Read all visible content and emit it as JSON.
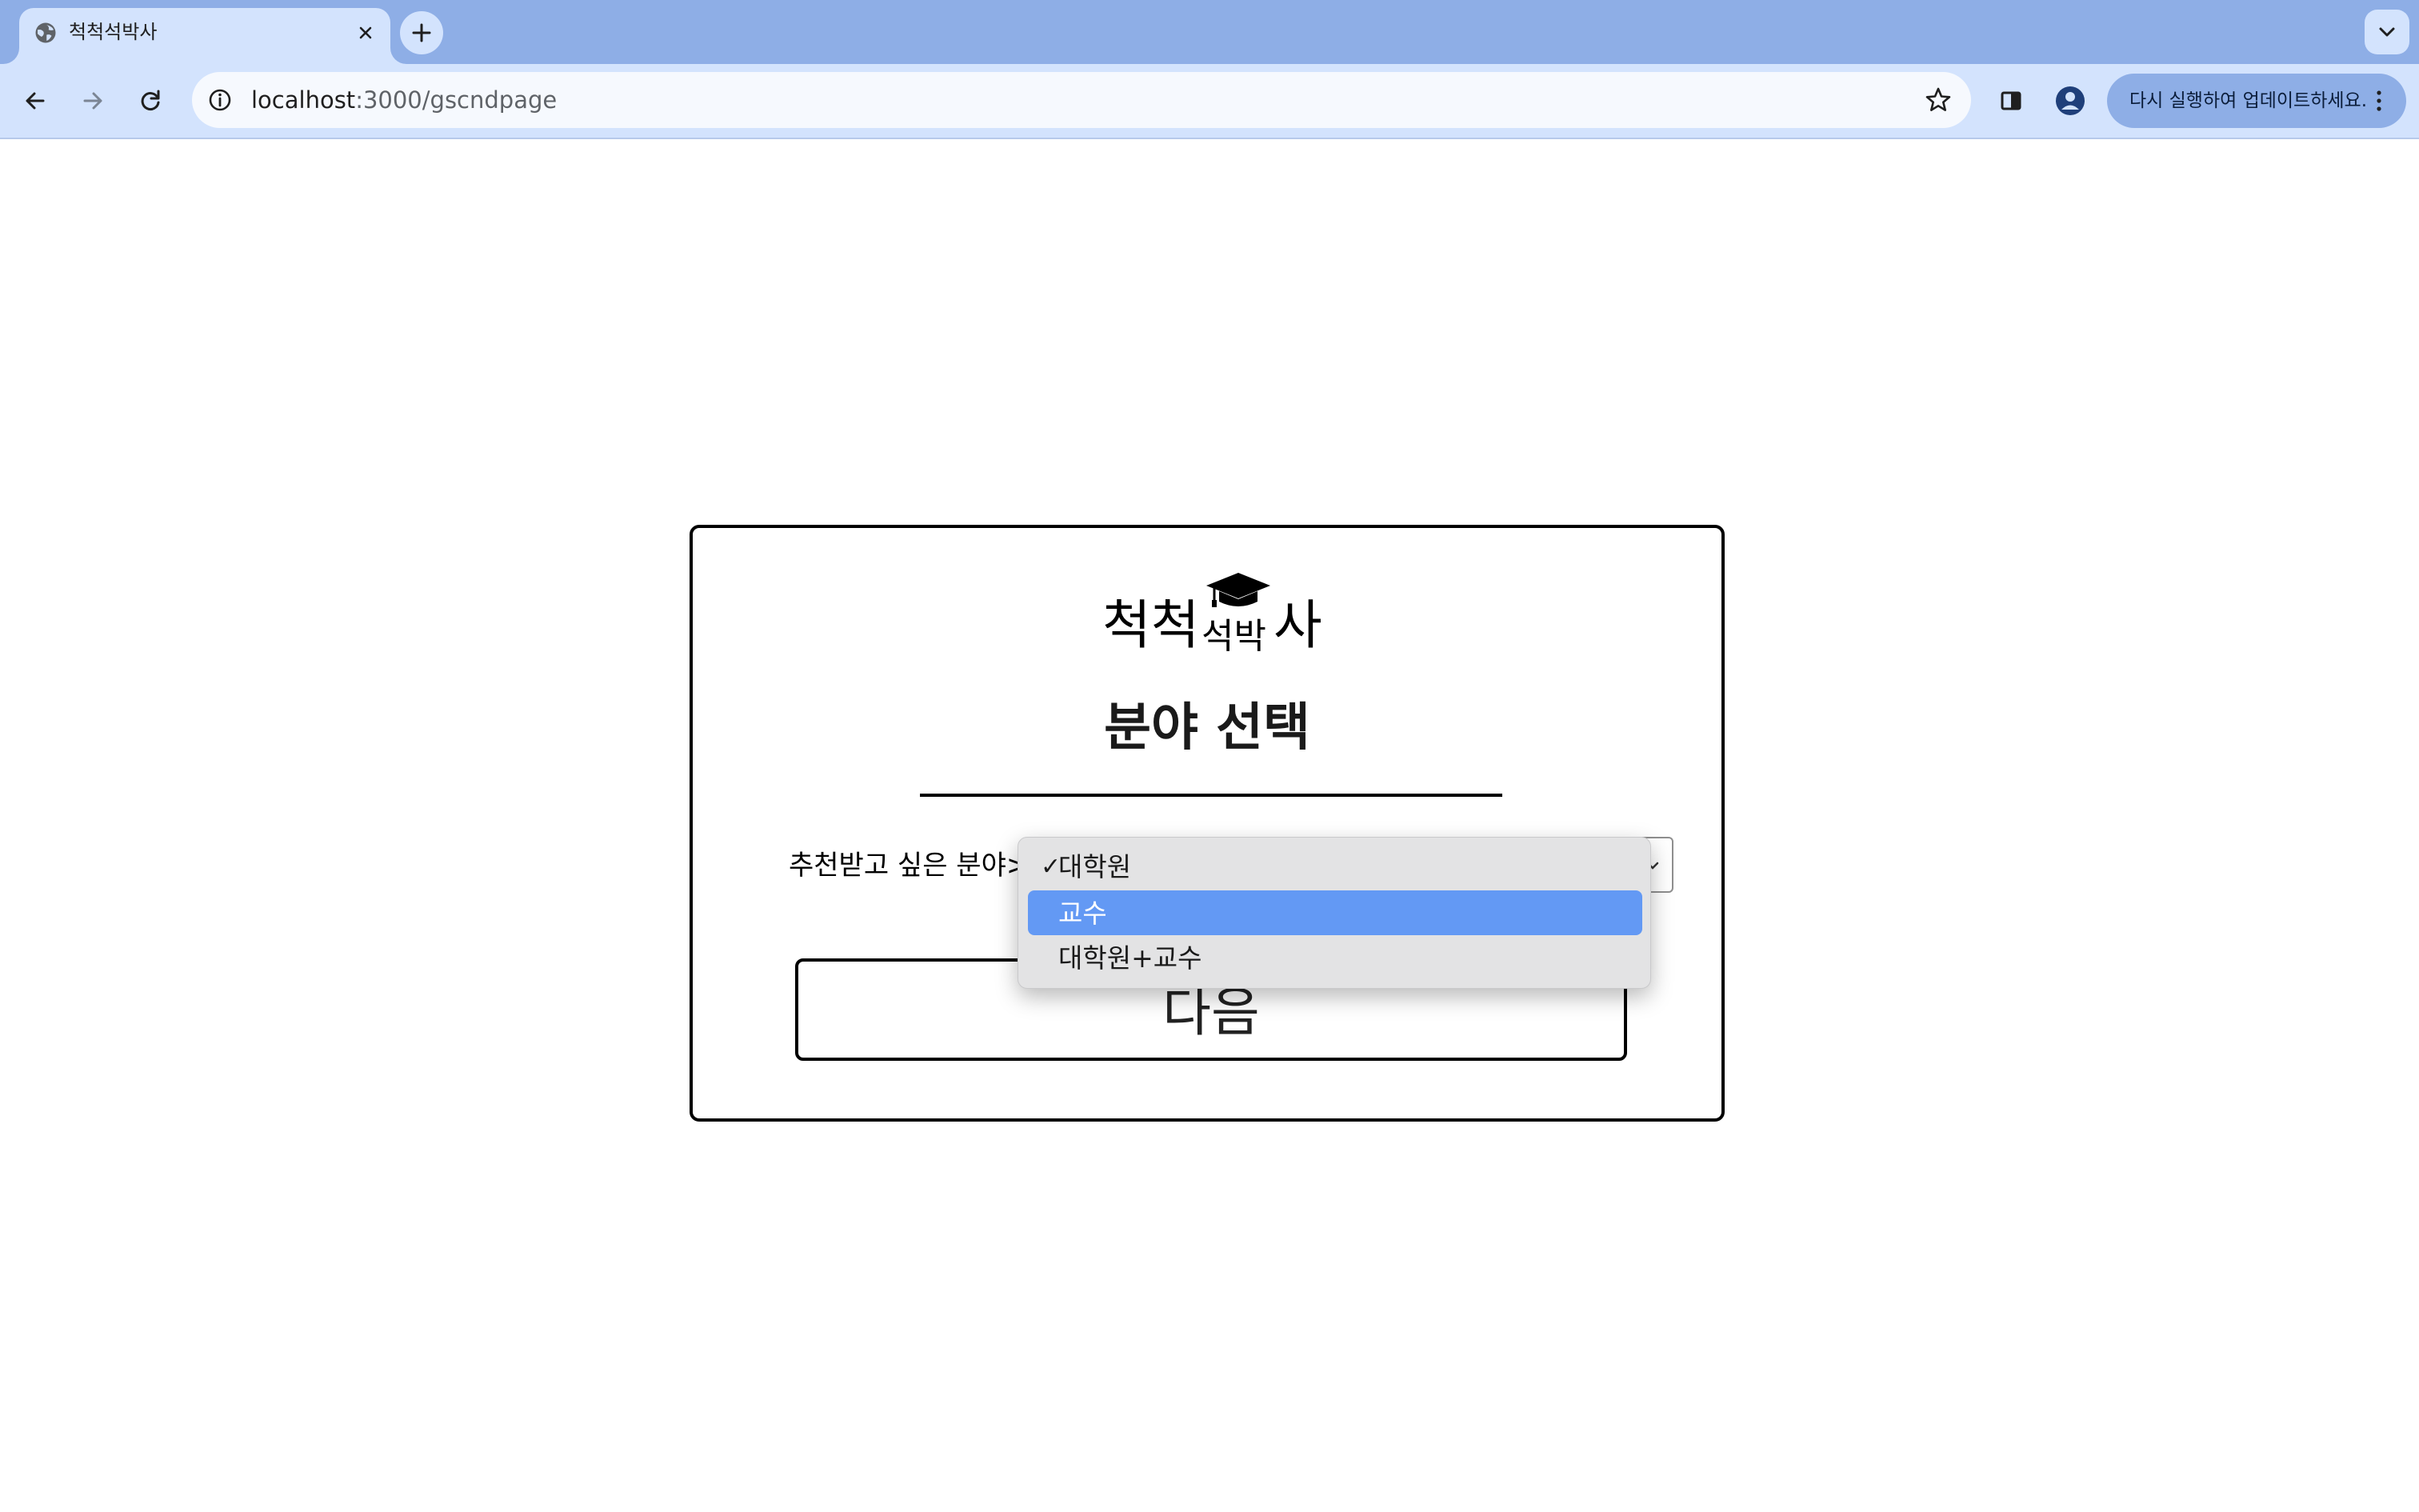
{
  "browser": {
    "tab": {
      "title": "척척석박사",
      "favicon": "globe-icon",
      "close_icon": "close-icon"
    },
    "new_tab_icon": "plus-icon",
    "tab_search_icon": "chevron-down-icon",
    "nav": {
      "back_icon": "back-arrow-icon",
      "forward_icon": "forward-arrow-icon",
      "reload_icon": "reload-icon"
    },
    "address": {
      "host": "localhost",
      "path": ":3000/gscndpage",
      "info_icon": "info-icon",
      "bookmark_icon": "star-icon"
    },
    "side_panel_icon": "side-panel-icon",
    "profile_icon": "profile-icon",
    "update": {
      "label": "다시 실행하여 업데이트하세요.",
      "menu_icon": "kebab-menu-icon"
    }
  },
  "page": {
    "logo": {
      "part1": "척척",
      "part2": "석박",
      "part3": "사",
      "icon": "graduation-cap-icon"
    },
    "title": "분야 선택",
    "field": {
      "label": "추천받고 싶은 분야>",
      "selected": "대학원",
      "options": [
        {
          "label": "대학원",
          "checked": true,
          "highlighted": false
        },
        {
          "label": "교수",
          "checked": false,
          "highlighted": true
        },
        {
          "label": "대학원+교수",
          "checked": false,
          "highlighted": false
        }
      ],
      "check_mark": "✓"
    },
    "next_button": "다음"
  },
  "colors": {
    "tabstrip": "#8eaee6",
    "toolbar": "#d3e3fd",
    "highlight": "#6399f4",
    "dropdown_bg": "#e3e3e4"
  }
}
